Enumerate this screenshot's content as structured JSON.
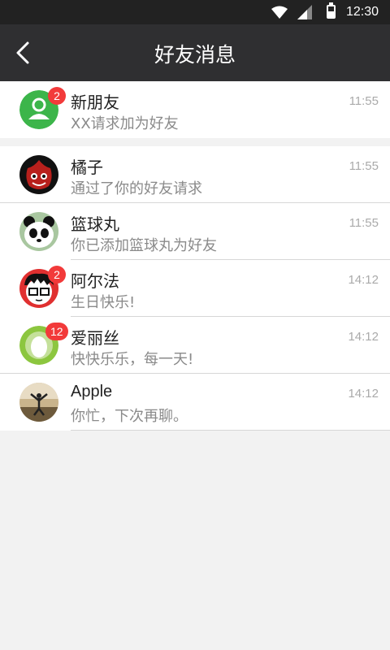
{
  "status_bar": {
    "time": "12:30",
    "icons": [
      "wifi-icon",
      "cell-signal-icon",
      "battery-icon"
    ]
  },
  "header": {
    "title": "好友消息",
    "back_icon": "chevron-left-icon"
  },
  "colors": {
    "header_bg": "#2f2f31",
    "badge": "#f23a3a",
    "new_friend_green": "#3cb54a",
    "background": "#f2f2f2"
  },
  "new_friend": {
    "name": "新朋友",
    "message": "XX请求加为好友",
    "time": "11:55",
    "badge": "2",
    "avatar_icon": "person-icon"
  },
  "messages": [
    {
      "name": "橘子",
      "message": "通过了你的好友请求",
      "time": "11:55",
      "badge": ""
    },
    {
      "name": "篮球丸",
      "message": "你已添加篮球丸为好友",
      "time": "11:55",
      "badge": ""
    },
    {
      "name": "阿尔法",
      "message": "生日快乐!",
      "time": "14:12",
      "badge": "2"
    },
    {
      "name": "爱丽丝",
      "message": "快快乐乐，每一天!",
      "time": "14:12",
      "badge": "12"
    },
    {
      "name": "Apple",
      "message": "你忙，下次再聊。",
      "time": "14:12",
      "badge": ""
    }
  ]
}
